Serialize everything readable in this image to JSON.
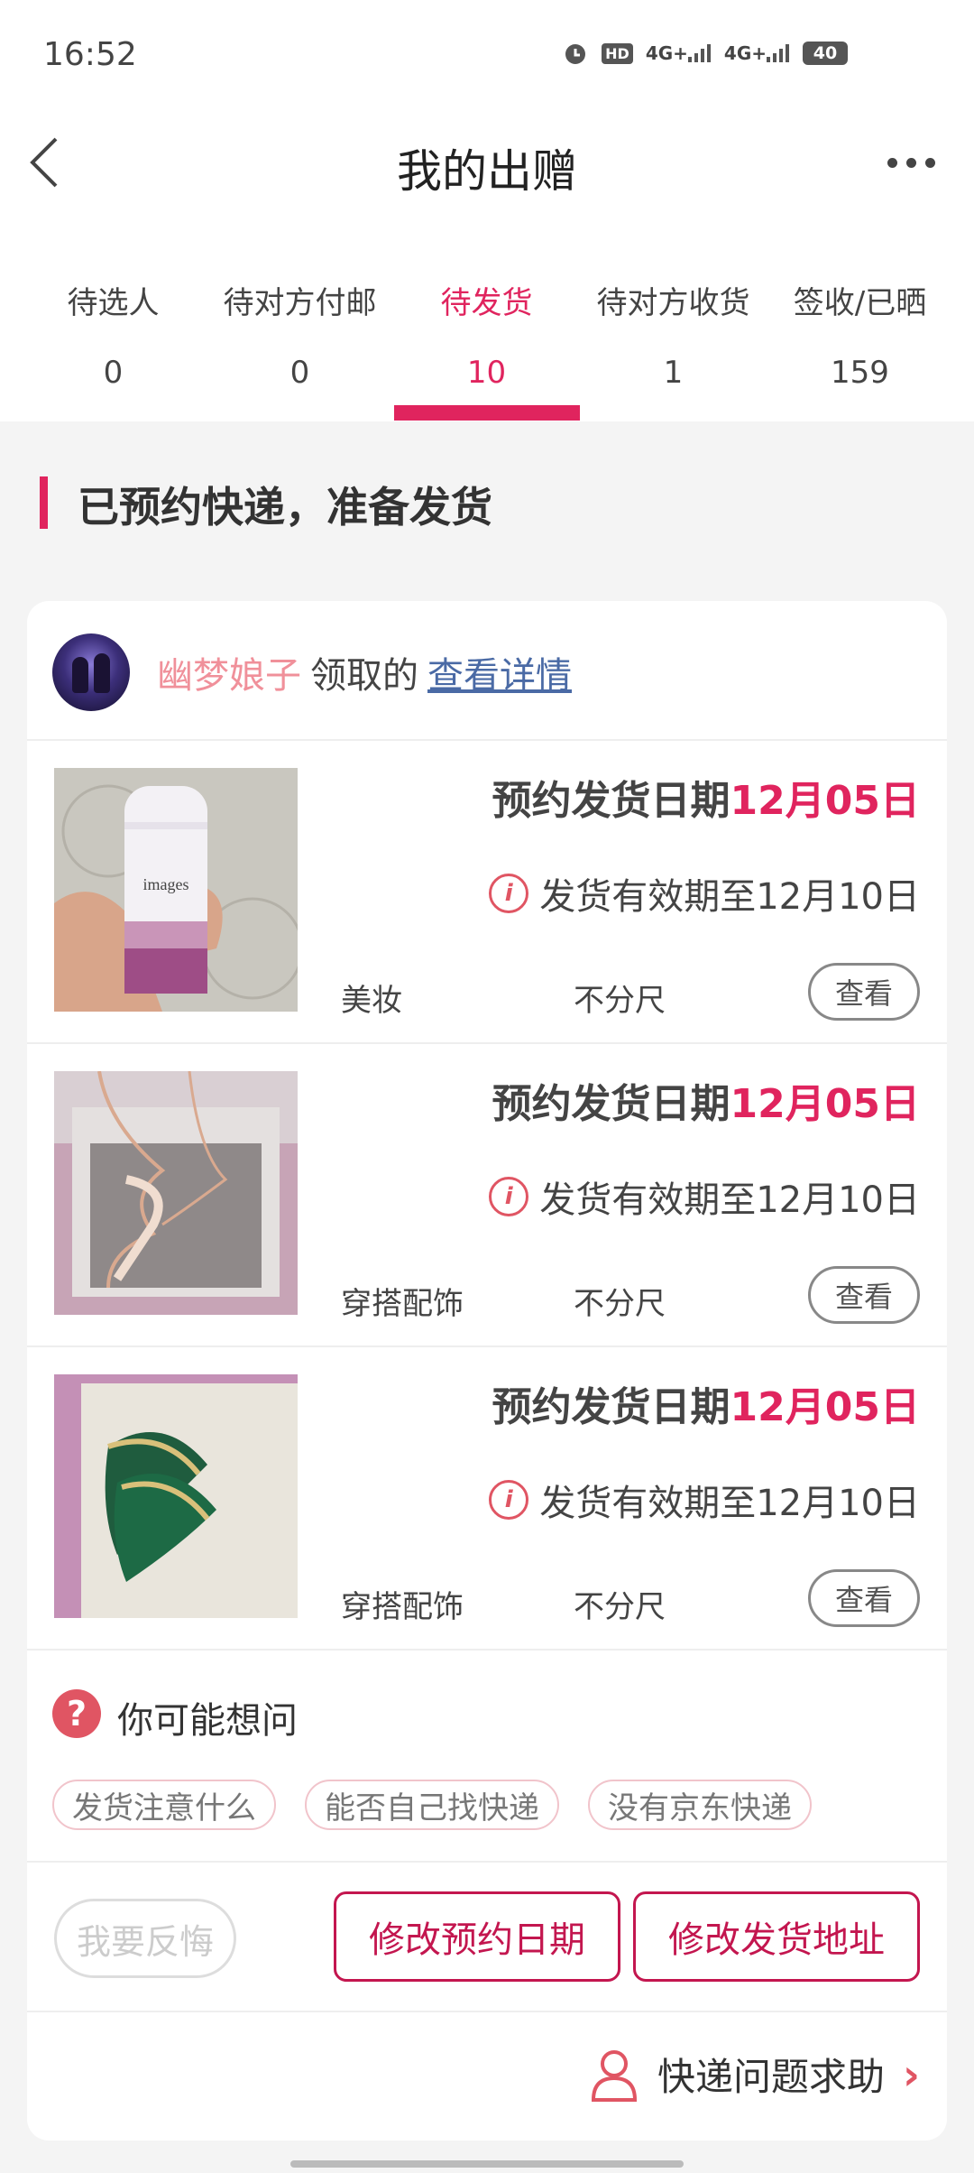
{
  "status": {
    "time": "16:52",
    "battery": "40",
    "hd": "HD",
    "signal1": "4G+",
    "signal2": "4G+"
  },
  "header": {
    "title": "我的出赠"
  },
  "tabs": [
    {
      "label": "待选人",
      "count": "0"
    },
    {
      "label": "待对方付邮",
      "count": "0"
    },
    {
      "label": "待发货",
      "count": "10"
    },
    {
      "label": "待对方收货",
      "count": "1"
    },
    {
      "label": "签收/已晒",
      "count": "159"
    }
  ],
  "section": {
    "title": "已预约快递，准备发货"
  },
  "giver": {
    "name": "幽梦娘子",
    "verb": "领取的",
    "link": "查看详情"
  },
  "items": [
    {
      "date_label": "预约发货日期",
      "date": "12月05日",
      "valid": "发货有效期至12月10日",
      "category": "美妆",
      "size": "不分尺",
      "view": "查看",
      "thumb": "deodorant-bottle-photo"
    },
    {
      "date_label": "预约发货日期",
      "date": "12月05日",
      "valid": "发货有效期至12月10日",
      "category": "穿搭配饰",
      "size": "不分尺",
      "view": "查看",
      "thumb": "necklace-in-box-photo"
    },
    {
      "date_label": "预约发货日期",
      "date": "12月05日",
      "valid": "发货有效期至12月10日",
      "category": "穿搭配饰",
      "size": "不分尺",
      "view": "查看",
      "thumb": "brooch-photo"
    }
  ],
  "faq": {
    "title": "你可能想问",
    "chips": [
      "发货注意什么",
      "能否自己找快递",
      "没有京东快递"
    ]
  },
  "actions": {
    "regret": "我要反悔",
    "change_date": "修改预约日期",
    "change_address": "修改发货地址"
  },
  "help": {
    "label": "快递问题求助"
  },
  "colors": {
    "accent": "#e0245e",
    "button_border": "#c3164f",
    "link": "#4a6aa5"
  }
}
